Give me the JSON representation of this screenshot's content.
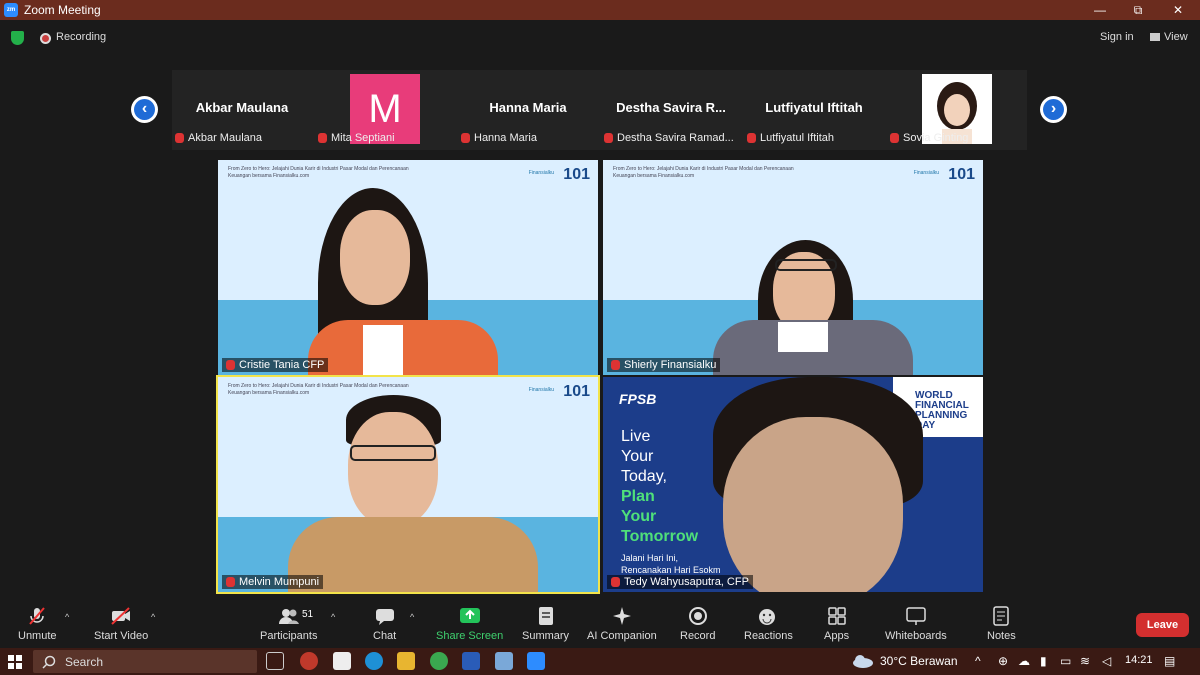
{
  "window": {
    "title": "Zoom Meeting",
    "minimize": "—",
    "restore": "⧉",
    "close": "✕"
  },
  "topbar": {
    "recording_label": "Recording",
    "signin_label": "Sign in",
    "view_label": "View"
  },
  "strip": {
    "participants": [
      {
        "display": "Akbar Maulana",
        "name": "Akbar Maulana"
      },
      {
        "display": "M",
        "name": "Mita Septiani"
      },
      {
        "display": "Hanna Maria",
        "name": "Hanna Maria"
      },
      {
        "display": "Destha Savira R...",
        "name": "Destha Savira Ramad..."
      },
      {
        "display": "Lutfiyatul Iftitah",
        "name": "Lutfiyatul Iftitah"
      },
      {
        "display": "",
        "name": "Sovia Ginting"
      }
    ],
    "prev_icon": "‹",
    "next_icon": "›"
  },
  "gallery": {
    "banner_text": "From Zero to Hero: Jelajahi Dunia Karir di Industri Pasar Modal dan Perencanaan Keuangan bersama Finansialku.com",
    "brand": "101",
    "brand_small": "Finansialku",
    "tiles": [
      {
        "name": "Cristie Tania CFP"
      },
      {
        "name": "Shierly Finansialku"
      },
      {
        "name": "Melvin Mumpuni"
      },
      {
        "name": "Tedy Wahyusaputra, CFP"
      }
    ],
    "fpb": {
      "logo": "FPSB",
      "line1": "Live",
      "line2": "Your",
      "line3": "Today,",
      "line4": "Plan",
      "line5": "Your",
      "line6": "Tomorrow",
      "sub1": "Jalani Hari Ini,",
      "sub2": "Rencanakan Hari Esokm",
      "wfpd1": "WORLD",
      "wfpd2": "FINANCIAL",
      "wfpd3": "PLANNING",
      "wfpd4": "DAY"
    }
  },
  "toolbar": {
    "unmute": "Unmute",
    "start_video": "Start Video",
    "participants": "Participants",
    "participants_count": "51",
    "chat": "Chat",
    "share_screen": "Share Screen",
    "summary": "Summary",
    "ai_companion": "AI Companion",
    "record": "Record",
    "reactions": "Reactions",
    "apps": "Apps",
    "whiteboards": "Whiteboards",
    "notes": "Notes",
    "leave": "Leave"
  },
  "taskbar": {
    "search_placeholder": "Search",
    "weather": "30°C  Berawan",
    "time": "14:21"
  },
  "colors": {
    "accent": "#2d8cff",
    "share_green": "#23c35a",
    "leave_red": "#d32f2f",
    "active_speaker": "#f2e34a"
  }
}
